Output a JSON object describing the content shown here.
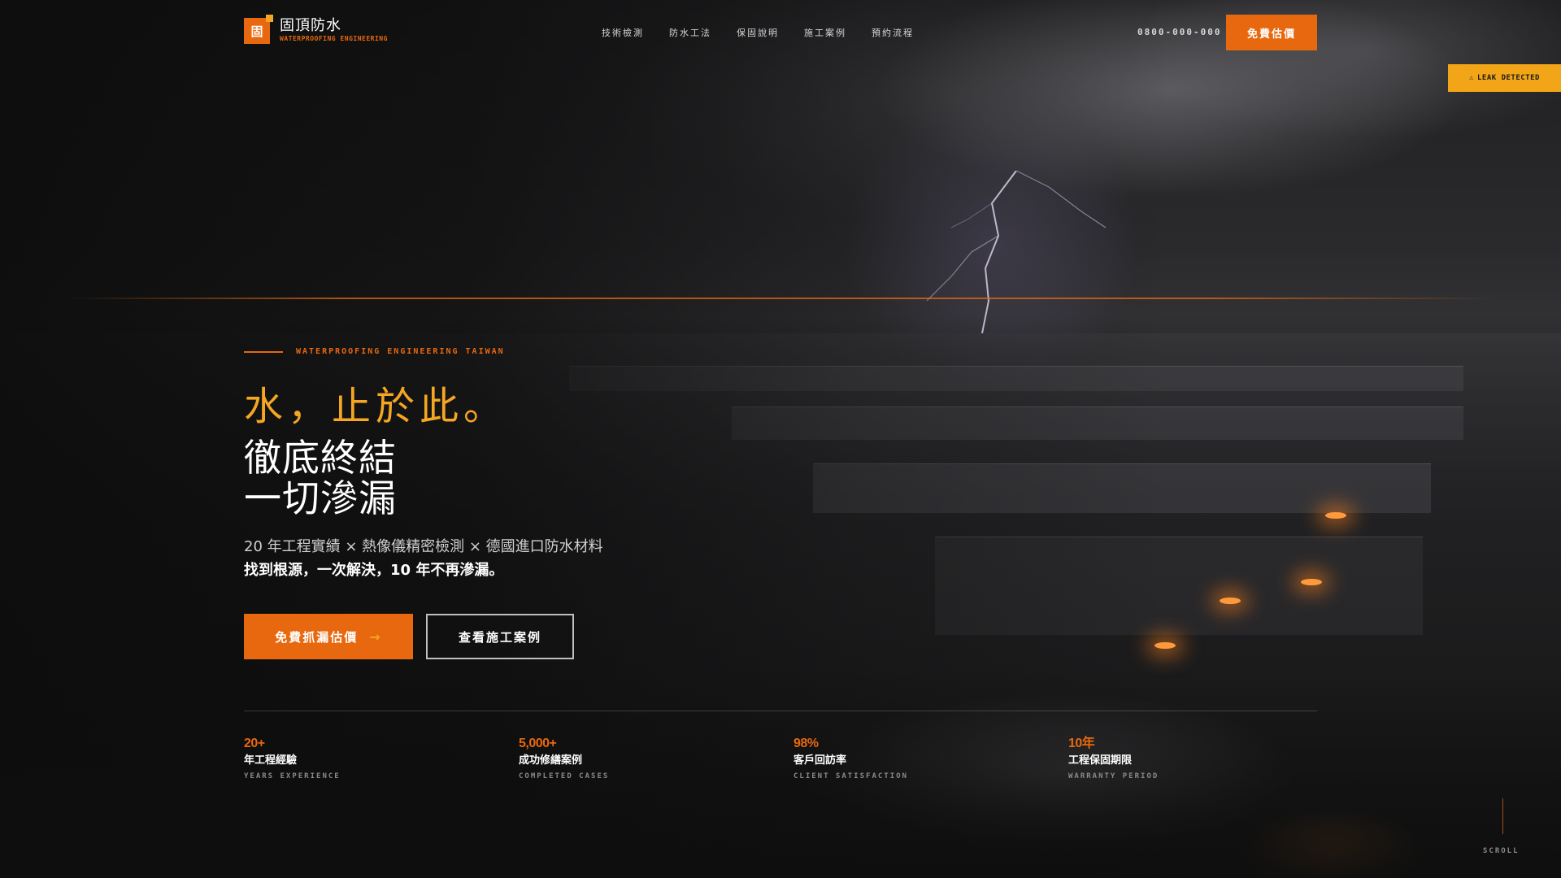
{
  "brand": {
    "mark": "固",
    "name": "固頂防水",
    "tagline": "WATERPROOFING ENGINEERING"
  },
  "nav": {
    "items": [
      "技術檢測",
      "防水工法",
      "保固說明",
      "施工案例",
      "預約流程"
    ]
  },
  "header": {
    "phone": "0800-000-000",
    "cta": "免費估價"
  },
  "badge": {
    "icon": "warning-icon",
    "glyph": "⚠",
    "text": "LEAK DETECTED"
  },
  "hero": {
    "eyebrow": "WATERPROOFING ENGINEERING TAIWAN",
    "headline_accent": "水，止於此。",
    "headline_line1": "徹底終結",
    "headline_line2": "一切滲漏",
    "sub_line1": "20 年工程實績 × 熱像儀精密檢測 × 德國進口防水材料",
    "sub_line2": "找到根源，一次解決，10 年不再滲漏。",
    "primary_button": "免費抓漏估價",
    "primary_arrow": "→",
    "secondary_button": "查看施工案例"
  },
  "stats": [
    {
      "value": "20+",
      "label": "年工程經驗",
      "sublabel": "YEARS EXPERIENCE"
    },
    {
      "value": "5,000+",
      "label": "成功修繕案例",
      "sublabel": "COMPLETED CASES"
    },
    {
      "value": "98%",
      "label": "客戶回訪率",
      "sublabel": "CLIENT SATISFACTION"
    },
    {
      "value": "10年",
      "label": "工程保固期限",
      "sublabel": "WARRANTY PERIOD"
    }
  ],
  "scroll": {
    "label": "SCROLL"
  },
  "colors": {
    "accent": "#e8680f",
    "accent_light": "#f5a623",
    "badge": "#f2a516",
    "background": "#121212"
  }
}
